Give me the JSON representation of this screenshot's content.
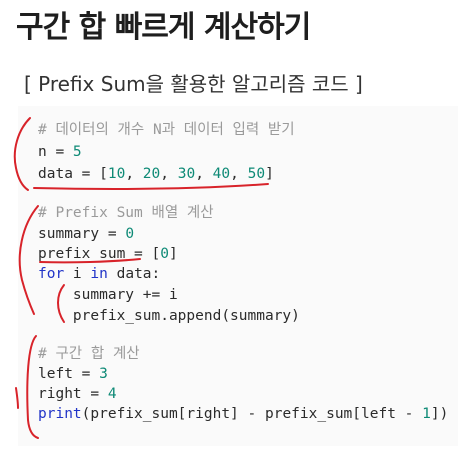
{
  "title": "구간 합 빠르게 계산하기",
  "subtitle": "[ Prefix Sum을 활용한 알고리즘 코드 ]",
  "code": {
    "l1_comment": "# 데이터의 개수 N과 데이터 입력 받기",
    "l2_a": "n = ",
    "l2_num": "5",
    "l3_a": "data = [",
    "l3_n1": "10",
    "l3_s1": ", ",
    "l3_n2": "20",
    "l3_s2": ", ",
    "l3_n3": "30",
    "l3_s3": ", ",
    "l3_n4": "40",
    "l3_s4": ", ",
    "l3_n5": "50",
    "l3_b": "]",
    "l4_comment": "# Prefix Sum 배열 계산",
    "l5_a": "summary = ",
    "l5_num": "0",
    "l6_a": "prefix_sum = [",
    "l6_num": "0",
    "l6_b": "]",
    "l7_kw1": "for",
    "l7_a": " i ",
    "l7_kw2": "in",
    "l7_b": " data:",
    "l8": "    summary += i",
    "l9": "    prefix_sum.append(summary)",
    "l10_comment": "# 구간 합 계산",
    "l11_a": "left = ",
    "l11_num": "3",
    "l12_a": "right = ",
    "l12_num": "4",
    "l13_fn": "print",
    "l13_a": "(prefix_sum[right] - prefix_sum[left - ",
    "l13_num": "1",
    "l13_b": "])"
  }
}
